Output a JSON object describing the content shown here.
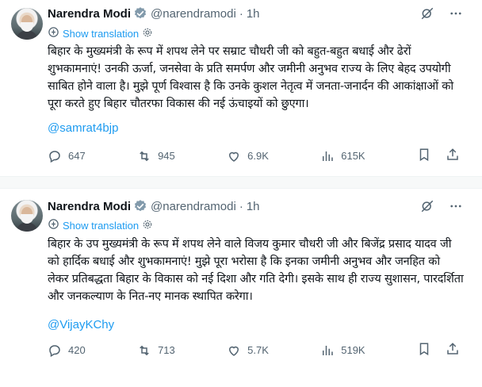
{
  "tweets": [
    {
      "author_name": "Narendra Modi",
      "handle": "@narendramodi",
      "separator": "·",
      "time": "1h",
      "show_translation": "Show translation",
      "text": "बिहार के मुख्यमंत्री के रूप में शपथ लेने पर सम्राट चौधरी जी को बहुत-बहुत बधाई और ढेरों शुभकामनाएं! उनकी ऊर्जा, जनसेवा के प्रति समर्पण और जमीनी अनुभव राज्य के लिए बेहद उपयोगी साबित होने वाला है। मुझे पूर्ण विश्वास है कि उनके कुशल नेतृत्व में जनता-जनार्दन की आकांक्षाओं को पूरा करते हुए बिहार चौतरफा विकास की नई ऊंचाइयों को छुएगा।",
      "mention": "@samrat4bjp",
      "replies": "647",
      "reposts": "945",
      "likes": "6.9K",
      "views": "615K"
    },
    {
      "author_name": "Narendra Modi",
      "handle": "@narendramodi",
      "separator": "·",
      "time": "1h",
      "show_translation": "Show translation",
      "text": "बिहार के उप मुख्यमंत्री के रूप में शपथ लेने वाले विजय कुमार चौधरी जी और बिजेंद्र प्रसाद यादव जी को हार्दिक बधाई और शुभकामनाएं! मुझे पूरा भरोसा है कि इनका जमीनी अनुभव और जनहित को लेकर प्रतिबद्धता बिहार के विकास को नई दिशा और गति देगी। इसके साथ ही राज्य सुशासन, पारदर्शिता और जनकल्याण के नित-नए मानक स्थापित करेगा।",
      "mention": "@VijayKChy",
      "replies": "420",
      "reposts": "713",
      "likes": "5.7K",
      "views": "519K"
    }
  ],
  "colors": {
    "link": "#1d9bf0",
    "muted": "#536471",
    "text": "#0f1419",
    "divider": "#eff3f4"
  }
}
